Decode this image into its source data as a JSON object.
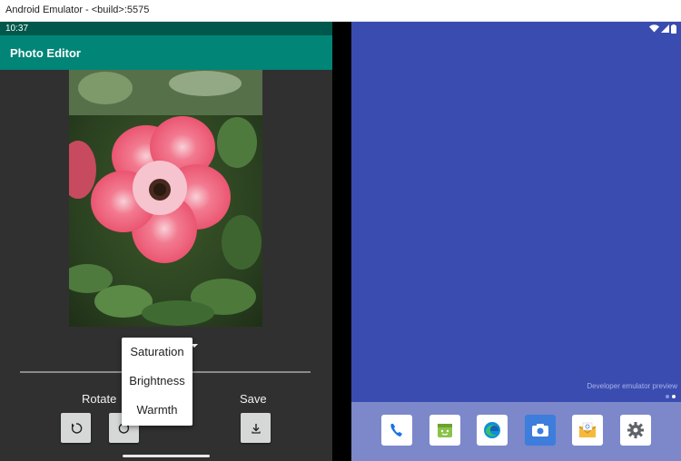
{
  "window": {
    "title": "Android Emulator - <build>:5575"
  },
  "status_bar": {
    "time": "10:37"
  },
  "app": {
    "title": "Photo Editor"
  },
  "controls": {
    "rotate_label": "Rotate",
    "save_label": "Save",
    "rotate_ccw_icon": "rotate-counterclockwise-icon",
    "rotate_cw_icon": "rotate-clockwise-icon",
    "save_icon": "download-icon"
  },
  "dropdown_menu": {
    "items": [
      {
        "label": "Saturation"
      },
      {
        "label": "Brightness"
      },
      {
        "label": "Warmth"
      }
    ]
  },
  "home_screen": {
    "developer_note": "Developer emulator preview",
    "dock_apps": [
      {
        "icon": "phone-icon"
      },
      {
        "icon": "store-icon"
      },
      {
        "icon": "edge-browser-icon"
      },
      {
        "icon": "camera-icon"
      },
      {
        "icon": "email-icon"
      },
      {
        "icon": "settings-gear-icon"
      }
    ]
  },
  "colors": {
    "app_bar": "#008577",
    "status_bar": "#00574b",
    "left_background": "#303030",
    "home_background": "#3a4cb0",
    "dock": "#7c88c9"
  }
}
